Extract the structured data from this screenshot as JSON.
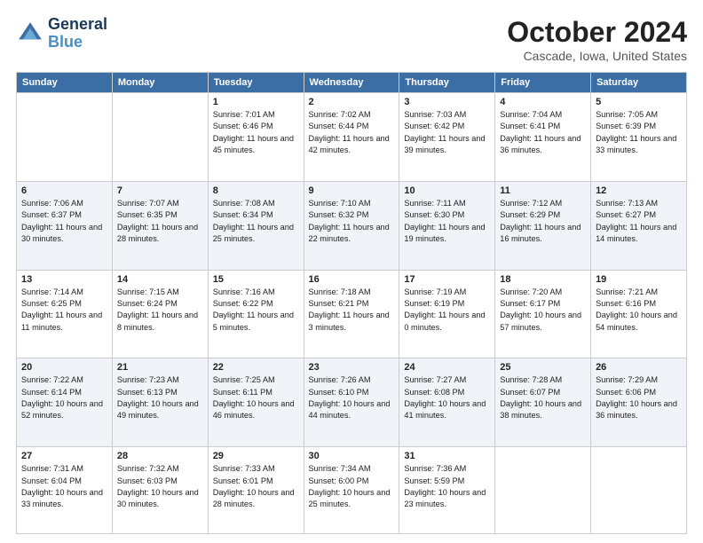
{
  "header": {
    "logo": "GeneralBlue",
    "title": "October 2024",
    "location": "Cascade, Iowa, United States"
  },
  "days_of_week": [
    "Sunday",
    "Monday",
    "Tuesday",
    "Wednesday",
    "Thursday",
    "Friday",
    "Saturday"
  ],
  "weeks": [
    [
      {
        "day": "",
        "info": ""
      },
      {
        "day": "",
        "info": ""
      },
      {
        "day": "1",
        "sunrise": "Sunrise: 7:01 AM",
        "sunset": "Sunset: 6:46 PM",
        "daylight": "Daylight: 11 hours and 45 minutes."
      },
      {
        "day": "2",
        "sunrise": "Sunrise: 7:02 AM",
        "sunset": "Sunset: 6:44 PM",
        "daylight": "Daylight: 11 hours and 42 minutes."
      },
      {
        "day": "3",
        "sunrise": "Sunrise: 7:03 AM",
        "sunset": "Sunset: 6:42 PM",
        "daylight": "Daylight: 11 hours and 39 minutes."
      },
      {
        "day": "4",
        "sunrise": "Sunrise: 7:04 AM",
        "sunset": "Sunset: 6:41 PM",
        "daylight": "Daylight: 11 hours and 36 minutes."
      },
      {
        "day": "5",
        "sunrise": "Sunrise: 7:05 AM",
        "sunset": "Sunset: 6:39 PM",
        "daylight": "Daylight: 11 hours and 33 minutes."
      }
    ],
    [
      {
        "day": "6",
        "sunrise": "Sunrise: 7:06 AM",
        "sunset": "Sunset: 6:37 PM",
        "daylight": "Daylight: 11 hours and 30 minutes."
      },
      {
        "day": "7",
        "sunrise": "Sunrise: 7:07 AM",
        "sunset": "Sunset: 6:35 PM",
        "daylight": "Daylight: 11 hours and 28 minutes."
      },
      {
        "day": "8",
        "sunrise": "Sunrise: 7:08 AM",
        "sunset": "Sunset: 6:34 PM",
        "daylight": "Daylight: 11 hours and 25 minutes."
      },
      {
        "day": "9",
        "sunrise": "Sunrise: 7:10 AM",
        "sunset": "Sunset: 6:32 PM",
        "daylight": "Daylight: 11 hours and 22 minutes."
      },
      {
        "day": "10",
        "sunrise": "Sunrise: 7:11 AM",
        "sunset": "Sunset: 6:30 PM",
        "daylight": "Daylight: 11 hours and 19 minutes."
      },
      {
        "day": "11",
        "sunrise": "Sunrise: 7:12 AM",
        "sunset": "Sunset: 6:29 PM",
        "daylight": "Daylight: 11 hours and 16 minutes."
      },
      {
        "day": "12",
        "sunrise": "Sunrise: 7:13 AM",
        "sunset": "Sunset: 6:27 PM",
        "daylight": "Daylight: 11 hours and 14 minutes."
      }
    ],
    [
      {
        "day": "13",
        "sunrise": "Sunrise: 7:14 AM",
        "sunset": "Sunset: 6:25 PM",
        "daylight": "Daylight: 11 hours and 11 minutes."
      },
      {
        "day": "14",
        "sunrise": "Sunrise: 7:15 AM",
        "sunset": "Sunset: 6:24 PM",
        "daylight": "Daylight: 11 hours and 8 minutes."
      },
      {
        "day": "15",
        "sunrise": "Sunrise: 7:16 AM",
        "sunset": "Sunset: 6:22 PM",
        "daylight": "Daylight: 11 hours and 5 minutes."
      },
      {
        "day": "16",
        "sunrise": "Sunrise: 7:18 AM",
        "sunset": "Sunset: 6:21 PM",
        "daylight": "Daylight: 11 hours and 3 minutes."
      },
      {
        "day": "17",
        "sunrise": "Sunrise: 7:19 AM",
        "sunset": "Sunset: 6:19 PM",
        "daylight": "Daylight: 11 hours and 0 minutes."
      },
      {
        "day": "18",
        "sunrise": "Sunrise: 7:20 AM",
        "sunset": "Sunset: 6:17 PM",
        "daylight": "Daylight: 10 hours and 57 minutes."
      },
      {
        "day": "19",
        "sunrise": "Sunrise: 7:21 AM",
        "sunset": "Sunset: 6:16 PM",
        "daylight": "Daylight: 10 hours and 54 minutes."
      }
    ],
    [
      {
        "day": "20",
        "sunrise": "Sunrise: 7:22 AM",
        "sunset": "Sunset: 6:14 PM",
        "daylight": "Daylight: 10 hours and 52 minutes."
      },
      {
        "day": "21",
        "sunrise": "Sunrise: 7:23 AM",
        "sunset": "Sunset: 6:13 PM",
        "daylight": "Daylight: 10 hours and 49 minutes."
      },
      {
        "day": "22",
        "sunrise": "Sunrise: 7:25 AM",
        "sunset": "Sunset: 6:11 PM",
        "daylight": "Daylight: 10 hours and 46 minutes."
      },
      {
        "day": "23",
        "sunrise": "Sunrise: 7:26 AM",
        "sunset": "Sunset: 6:10 PM",
        "daylight": "Daylight: 10 hours and 44 minutes."
      },
      {
        "day": "24",
        "sunrise": "Sunrise: 7:27 AM",
        "sunset": "Sunset: 6:08 PM",
        "daylight": "Daylight: 10 hours and 41 minutes."
      },
      {
        "day": "25",
        "sunrise": "Sunrise: 7:28 AM",
        "sunset": "Sunset: 6:07 PM",
        "daylight": "Daylight: 10 hours and 38 minutes."
      },
      {
        "day": "26",
        "sunrise": "Sunrise: 7:29 AM",
        "sunset": "Sunset: 6:06 PM",
        "daylight": "Daylight: 10 hours and 36 minutes."
      }
    ],
    [
      {
        "day": "27",
        "sunrise": "Sunrise: 7:31 AM",
        "sunset": "Sunset: 6:04 PM",
        "daylight": "Daylight: 10 hours and 33 minutes."
      },
      {
        "day": "28",
        "sunrise": "Sunrise: 7:32 AM",
        "sunset": "Sunset: 6:03 PM",
        "daylight": "Daylight: 10 hours and 30 minutes."
      },
      {
        "day": "29",
        "sunrise": "Sunrise: 7:33 AM",
        "sunset": "Sunset: 6:01 PM",
        "daylight": "Daylight: 10 hours and 28 minutes."
      },
      {
        "day": "30",
        "sunrise": "Sunrise: 7:34 AM",
        "sunset": "Sunset: 6:00 PM",
        "daylight": "Daylight: 10 hours and 25 minutes."
      },
      {
        "day": "31",
        "sunrise": "Sunrise: 7:36 AM",
        "sunset": "Sunset: 5:59 PM",
        "daylight": "Daylight: 10 hours and 23 minutes."
      },
      {
        "day": "",
        "info": ""
      },
      {
        "day": "",
        "info": ""
      }
    ]
  ]
}
